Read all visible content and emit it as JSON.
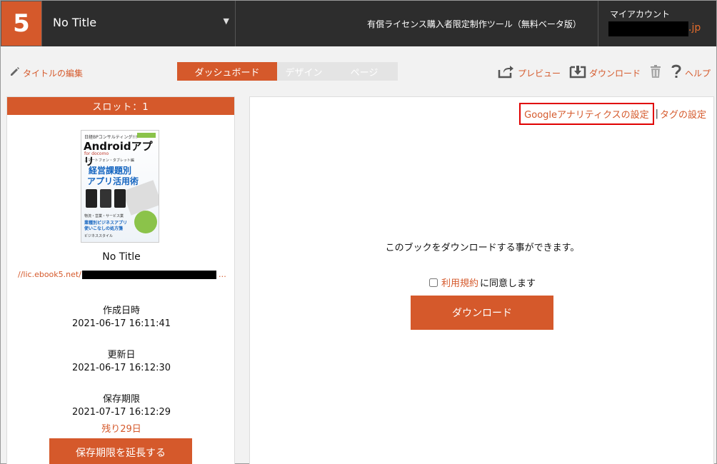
{
  "header": {
    "logo": "5",
    "book_title": "No Title",
    "dropdown_glyph": "▼",
    "tool_name": "有償ライセンス購入者限定制作ツール（無料ベータ版）",
    "account_label": "マイアカウント",
    "account_suffix": ".jp"
  },
  "toolbar": {
    "edit_title": "タイトルの編集",
    "tabs": [
      {
        "label": "ダッシュボード",
        "active": true
      },
      {
        "label": "デザイン",
        "active": false
      },
      {
        "label": "ページ",
        "active": false
      }
    ],
    "preview": "プレビュー",
    "download": "ダウンロード",
    "help": "ヘルプ"
  },
  "left_panel": {
    "slot": "スロット：1",
    "cover": {
      "top_text": "日経BPコンサルティング!!!",
      "title": "Androidアプリ",
      "subtitle": "for docomo",
      "sub_text": "スマートフォン・タブレット編",
      "main1": "経営課題別",
      "main2": "アプリ活用術",
      "bottom1": "物流・営業・サービス業",
      "bottom2": "業種別ビジネスアプリ",
      "bottom3": "使いこなしの処方箋",
      "bottom4": "ビジネススタイル"
    },
    "book_name": "No Title",
    "url_prefix": "//lic.ebook5.net/",
    "url_ellipsis": "…",
    "created_label": "作成日時",
    "created_value": "2021-06-17 16:11:41",
    "updated_label": "更新日",
    "updated_value": "2021-06-17 16:12:30",
    "expiry_label": "保存期限",
    "expiry_value": "2021-07-17 16:12:29",
    "remaining": "残り29日",
    "extend_button": "保存期限を延長する"
  },
  "right_panel": {
    "ga_link": "Googleアナリティクスの設定",
    "separator": "|",
    "tag_link": "タグの設定",
    "download_message": "このブックをダウンロードする事ができます。",
    "terms_link": "利用規約",
    "agree_suffix": "に同意します",
    "download_button": "ダウンロード"
  },
  "icons": {
    "pencil": "pencil-icon",
    "share": "share-icon",
    "download": "download-icon",
    "trash": "trash-icon",
    "help": "question-icon"
  },
  "colors": {
    "accent": "#d5592b",
    "header_bg": "#2d2d2d",
    "highlight": "#e00000"
  }
}
